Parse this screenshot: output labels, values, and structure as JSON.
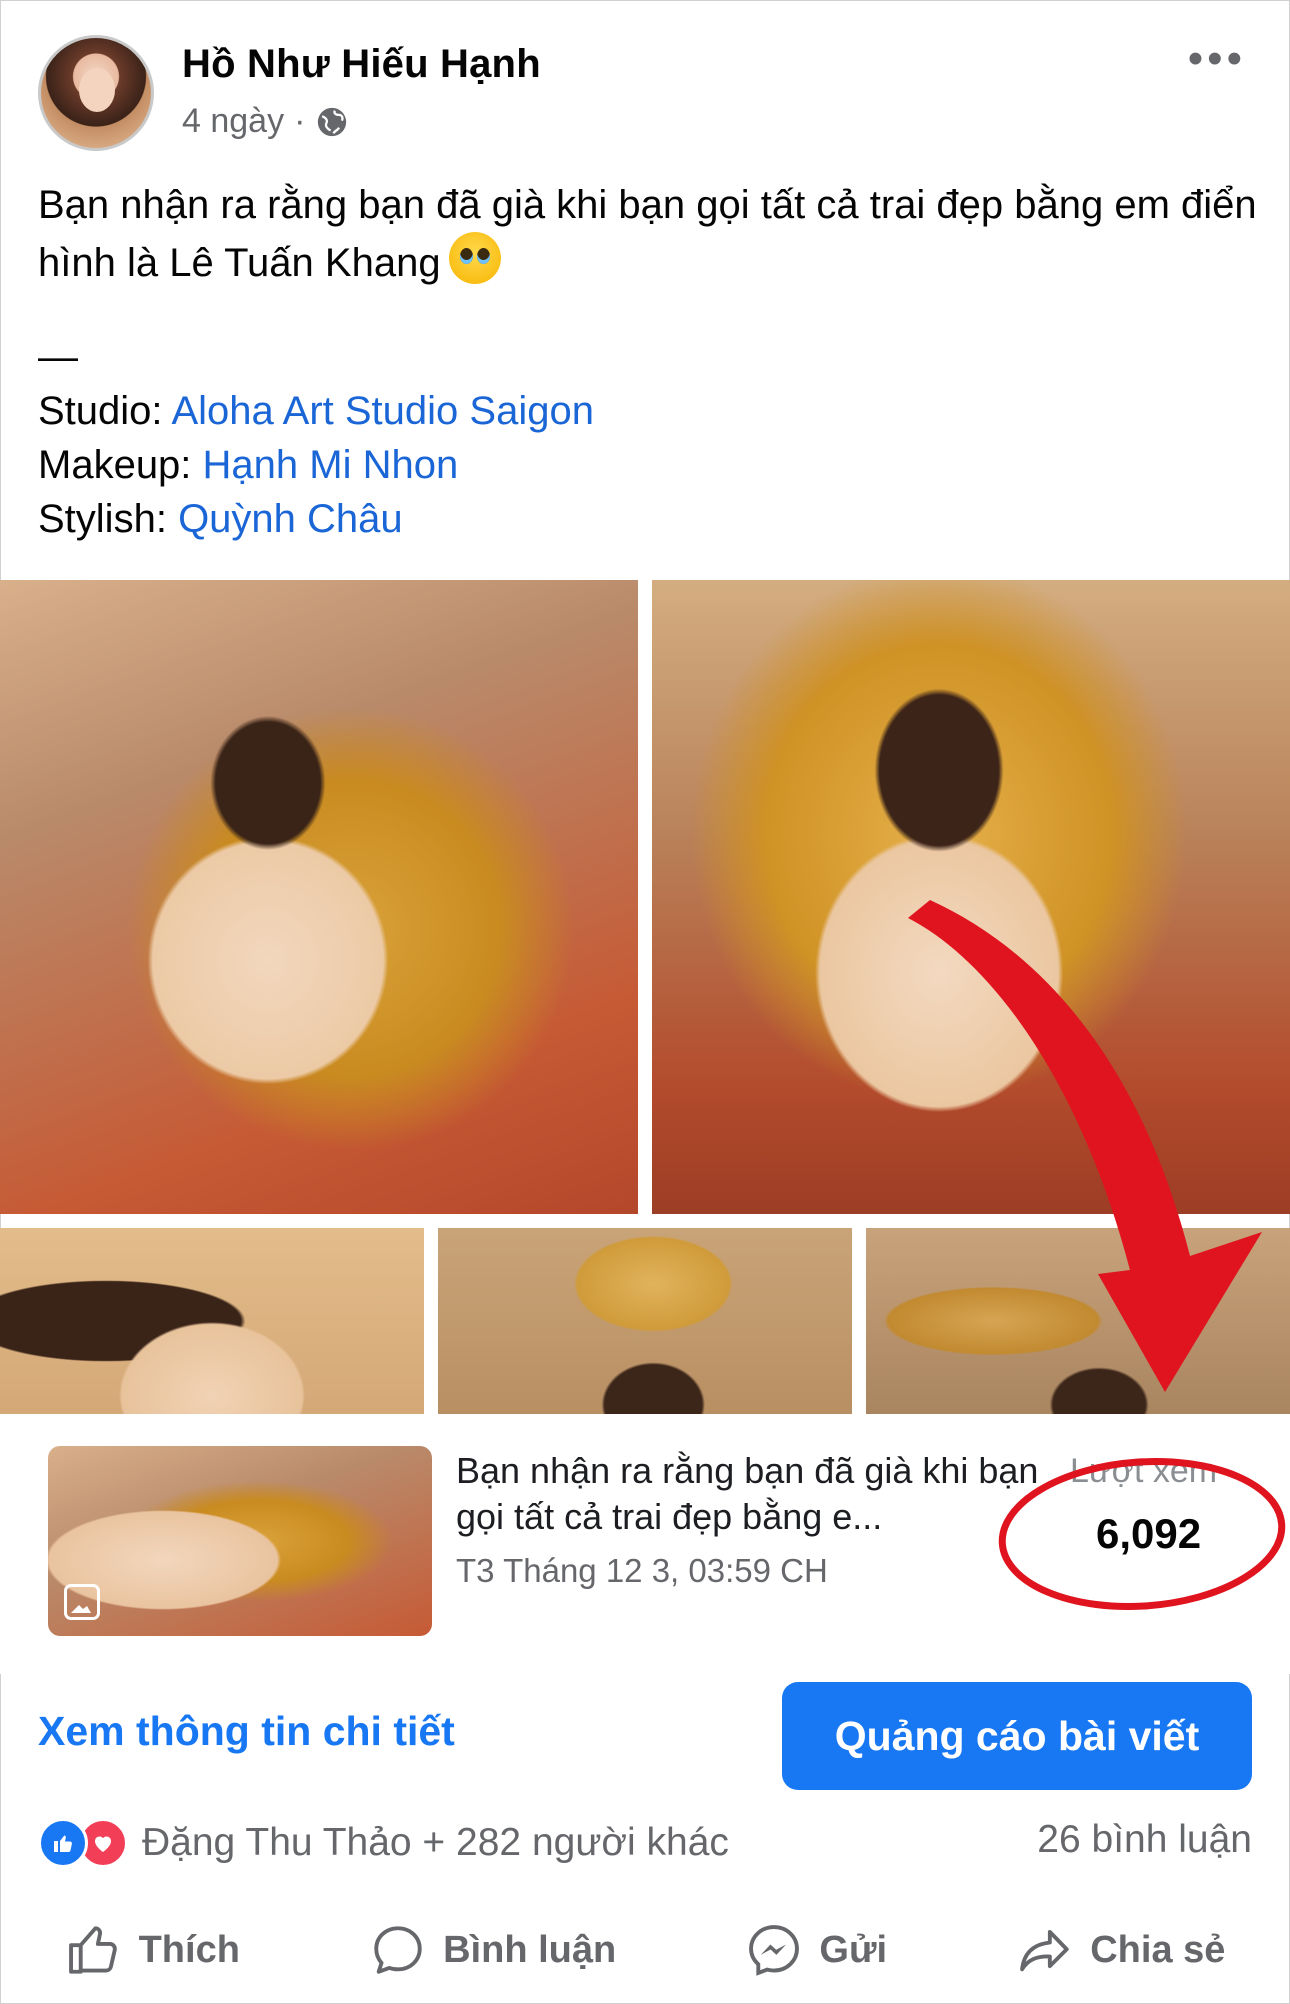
{
  "post": {
    "author": "Hồ Như Hiếu Hạnh",
    "time": "4 ngày",
    "separator": "·",
    "text_line1": "Bạn nhận ra rằng bạn đã già khi bạn gọi tất cả trai đẹp bằng em điển hình là Lê Tuấn Khang",
    "dash": "—",
    "credits": [
      {
        "label": "Studio:",
        "value": "Aloha Art Studio Saigon"
      },
      {
        "label": "Makeup:",
        "value": "Hạnh Mi Nhon"
      },
      {
        "label": "Stylish:",
        "value": "Quỳnh Châu"
      }
    ]
  },
  "insights": {
    "title": "Bạn nhận ra rằng bạn đã già khi bạn gọi tất cả trai đẹp bằng e...",
    "date": "T3 Tháng 12 3, 03:59 CH",
    "views_label": "Lượt xem",
    "views_value": "6,092"
  },
  "actions": {
    "details_link": "Xem thông tin chi tiết",
    "boost_button": "Quảng cáo bài viết"
  },
  "reactions": {
    "summary": "Đặng Thu Thảo + 282 người khác",
    "comments": "26 bình luận"
  },
  "footer": {
    "like": "Thích",
    "comment": "Bình luận",
    "send": "Gửi",
    "share": "Chia sẻ"
  },
  "icons": [
    "globe-icon",
    "more-icon",
    "like-reaction-icon",
    "love-reaction-icon",
    "thumbs-up-icon",
    "comment-icon",
    "messenger-icon",
    "share-icon",
    "photo-icon"
  ],
  "colors": {
    "link": "#1a66d6",
    "accent": "#1877f2",
    "annotation": "#e0141e"
  }
}
